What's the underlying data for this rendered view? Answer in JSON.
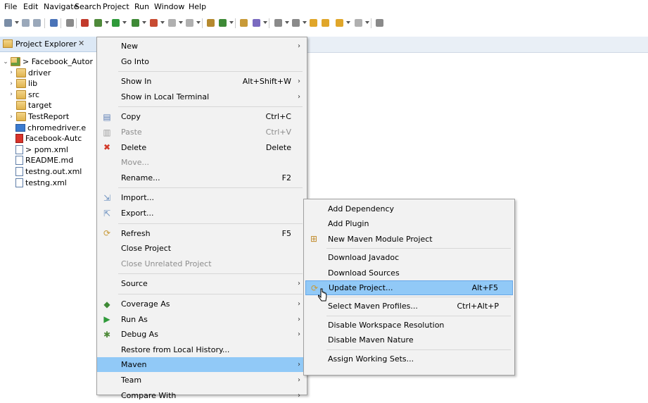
{
  "menubar": [
    "File",
    "Edit",
    "Navigate",
    "Search",
    "Project",
    "Run",
    "Window",
    "Help"
  ],
  "explorer": {
    "tab_label": "Project Explorer",
    "close_glyph": "✕",
    "tree": [
      {
        "label": "> Facebook_Autor",
        "twisty": "⌄",
        "icon": "project-icon"
      },
      {
        "label": "driver",
        "twisty": "›",
        "icon": "folder-icon"
      },
      {
        "label": "lib",
        "twisty": "›",
        "icon": "folder-icon"
      },
      {
        "label": "src",
        "twisty": "›",
        "icon": "folder-icon"
      },
      {
        "label": "target",
        "twisty": "",
        "icon": "folder-icon"
      },
      {
        "label": "TestReport",
        "twisty": "›",
        "icon": "folder-icon"
      },
      {
        "label": "chromedriver.e",
        "twisty": "",
        "icon": "exe-file-icon"
      },
      {
        "label": "Facebook-Autc",
        "twisty": "",
        "icon": "red-file-icon"
      },
      {
        "label": "> pom.xml",
        "twisty": "",
        "icon": "maven-file-icon"
      },
      {
        "label": "README.md",
        "twisty": "",
        "icon": "md-file-icon"
      },
      {
        "label": "testng.out.xml",
        "twisty": "",
        "icon": "xml-file-icon"
      },
      {
        "label": "testng.xml",
        "twisty": "",
        "icon": "xml-file-icon"
      }
    ]
  },
  "context_menu": {
    "items": [
      {
        "label": "New",
        "key": "",
        "arrow": "›",
        "icon": "",
        "disabled": false
      },
      {
        "label": "Go Into",
        "key": "",
        "arrow": "",
        "icon": "",
        "disabled": false
      },
      {
        "sep": true
      },
      {
        "label": "Show In",
        "key": "Alt+Shift+W",
        "arrow": "›",
        "icon": "",
        "disabled": false
      },
      {
        "label": "Show in Local Terminal",
        "key": "",
        "arrow": "›",
        "icon": "",
        "disabled": false
      },
      {
        "sep": true
      },
      {
        "label": "Copy",
        "key": "Ctrl+C",
        "arrow": "",
        "icon": "copy-icon",
        "disabled": false
      },
      {
        "label": "Paste",
        "key": "Ctrl+V",
        "arrow": "",
        "icon": "paste-icon",
        "disabled": true
      },
      {
        "label": "Delete",
        "key": "Delete",
        "arrow": "",
        "icon": "delete-icon",
        "disabled": false
      },
      {
        "label": "Move...",
        "key": "",
        "arrow": "",
        "icon": "",
        "disabled": true
      },
      {
        "label": "Rename...",
        "key": "F2",
        "arrow": "",
        "icon": "",
        "disabled": false
      },
      {
        "sep": true
      },
      {
        "label": "Import...",
        "key": "",
        "arrow": "",
        "icon": "import-icon",
        "disabled": false
      },
      {
        "label": "Export...",
        "key": "",
        "arrow": "",
        "icon": "export-icon",
        "disabled": false
      },
      {
        "sep": true
      },
      {
        "label": "Refresh",
        "key": "F5",
        "arrow": "",
        "icon": "refresh-icon",
        "disabled": false
      },
      {
        "label": "Close Project",
        "key": "",
        "arrow": "",
        "icon": "",
        "disabled": false
      },
      {
        "label": "Close Unrelated Project",
        "key": "",
        "arrow": "",
        "icon": "",
        "disabled": true
      },
      {
        "sep": true
      },
      {
        "label": "Source",
        "key": "",
        "arrow": "›",
        "icon": "",
        "disabled": false
      },
      {
        "sep": true
      },
      {
        "label": "Coverage As",
        "key": "",
        "arrow": "›",
        "icon": "coverage-icon",
        "disabled": false
      },
      {
        "label": "Run As",
        "key": "",
        "arrow": "›",
        "icon": "run-icon",
        "disabled": false
      },
      {
        "label": "Debug As",
        "key": "",
        "arrow": "›",
        "icon": "debug-icon",
        "disabled": false
      },
      {
        "label": "Restore from Local History...",
        "key": "",
        "arrow": "",
        "icon": "",
        "disabled": false
      },
      {
        "label": "Maven",
        "key": "",
        "arrow": "›",
        "icon": "",
        "disabled": false,
        "highlight": true
      },
      {
        "label": "Team",
        "key": "",
        "arrow": "›",
        "icon": "",
        "disabled": false
      },
      {
        "label": "Compare With",
        "key": "",
        "arrow": "›",
        "icon": "",
        "disabled": false
      }
    ]
  },
  "maven_submenu": {
    "items": [
      {
        "label": "Add Dependency",
        "key": "",
        "icon": ""
      },
      {
        "label": "Add Plugin",
        "key": "",
        "icon": ""
      },
      {
        "label": "New Maven Module Project",
        "key": "",
        "icon": "maven-module-icon"
      },
      {
        "sep": true
      },
      {
        "label": "Download Javadoc",
        "key": "",
        "icon": ""
      },
      {
        "label": "Download Sources",
        "key": "",
        "icon": ""
      },
      {
        "label": "Update Project...",
        "key": "Alt+F5",
        "icon": "update-project-icon",
        "highlight": true
      },
      {
        "sep": true
      },
      {
        "label": "Select Maven Profiles...",
        "key": "Ctrl+Alt+P",
        "icon": ""
      },
      {
        "sep": true
      },
      {
        "label": "Disable Workspace Resolution",
        "key": "",
        "icon": ""
      },
      {
        "label": "Disable Maven Nature",
        "key": "",
        "icon": ""
      },
      {
        "sep": true
      },
      {
        "label": "Assign Working Sets...",
        "key": "",
        "icon": ""
      }
    ]
  },
  "colors": {
    "highlight": "#91c9f7",
    "menu_bg": "#f2f2f2",
    "disabled_text": "#8d8d8d"
  }
}
